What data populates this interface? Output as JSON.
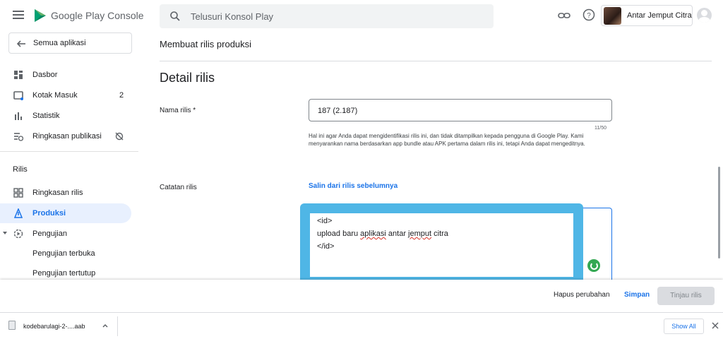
{
  "topbar": {
    "brand": "Google Play Console",
    "search_placeholder": "Telusuri Konsol Play",
    "account_name": "Antar Jemput Citra"
  },
  "sidebar": {
    "all_apps": "Semua aplikasi",
    "items": [
      {
        "label": "Dasbor",
        "icon": "dashboard-icon"
      },
      {
        "label": "Kotak Masuk",
        "icon": "inbox-icon",
        "badge": "2"
      },
      {
        "label": "Statistik",
        "icon": "bar-chart-icon"
      },
      {
        "label": "Ringkasan publikasi",
        "icon": "publishing-icon",
        "trail_icon": "sync-off-icon"
      }
    ],
    "section": "Rilis",
    "release_items": [
      {
        "label": "Ringkasan rilis",
        "icon": "grid-icon"
      },
      {
        "label": "Produksi",
        "icon": "production-icon",
        "active": true
      },
      {
        "label": "Pengujian",
        "icon": "testing-icon"
      },
      {
        "label": "Pengujian terbuka"
      },
      {
        "label": "Pengujian tertutup"
      }
    ]
  },
  "main": {
    "page_header": "Membuat rilis produksi",
    "section_title": "Detail rilis",
    "release_name_label": "Nama rilis",
    "required_mark": "*",
    "release_name_value": "187 (2.187)",
    "counter": "11/50",
    "helper": "Hal ini agar Anda dapat mengidentifikasi rilis ini, dan tidak ditampilkan kepada pengguna di Google Play. Kami menyarankan nama berdasarkan app bundle atau APK pertama dalam rilis ini, tetapi Anda dapat mengeditnya.",
    "notes_label": "Catatan rilis",
    "copy_link": "Salin dari rilis sebelumnya",
    "notes": {
      "line1": "<id>",
      "line2_a": "upload baru ",
      "line2_b": "aplikasi",
      "line2_c": " antar ",
      "line2_d": "jemput",
      "line2_e": " citra",
      "line3": "</id>"
    }
  },
  "actions": {
    "discard": "Hapus perubahan",
    "save": "Simpan",
    "review": "Tinjau rilis"
  },
  "downloads": {
    "file_name": "kodebarulagi-2-....aab",
    "show_all": "Show All"
  },
  "colors": {
    "accent": "#1a73e8",
    "highlight": "#4fb6e6",
    "active_bg": "#e8f0fe"
  }
}
